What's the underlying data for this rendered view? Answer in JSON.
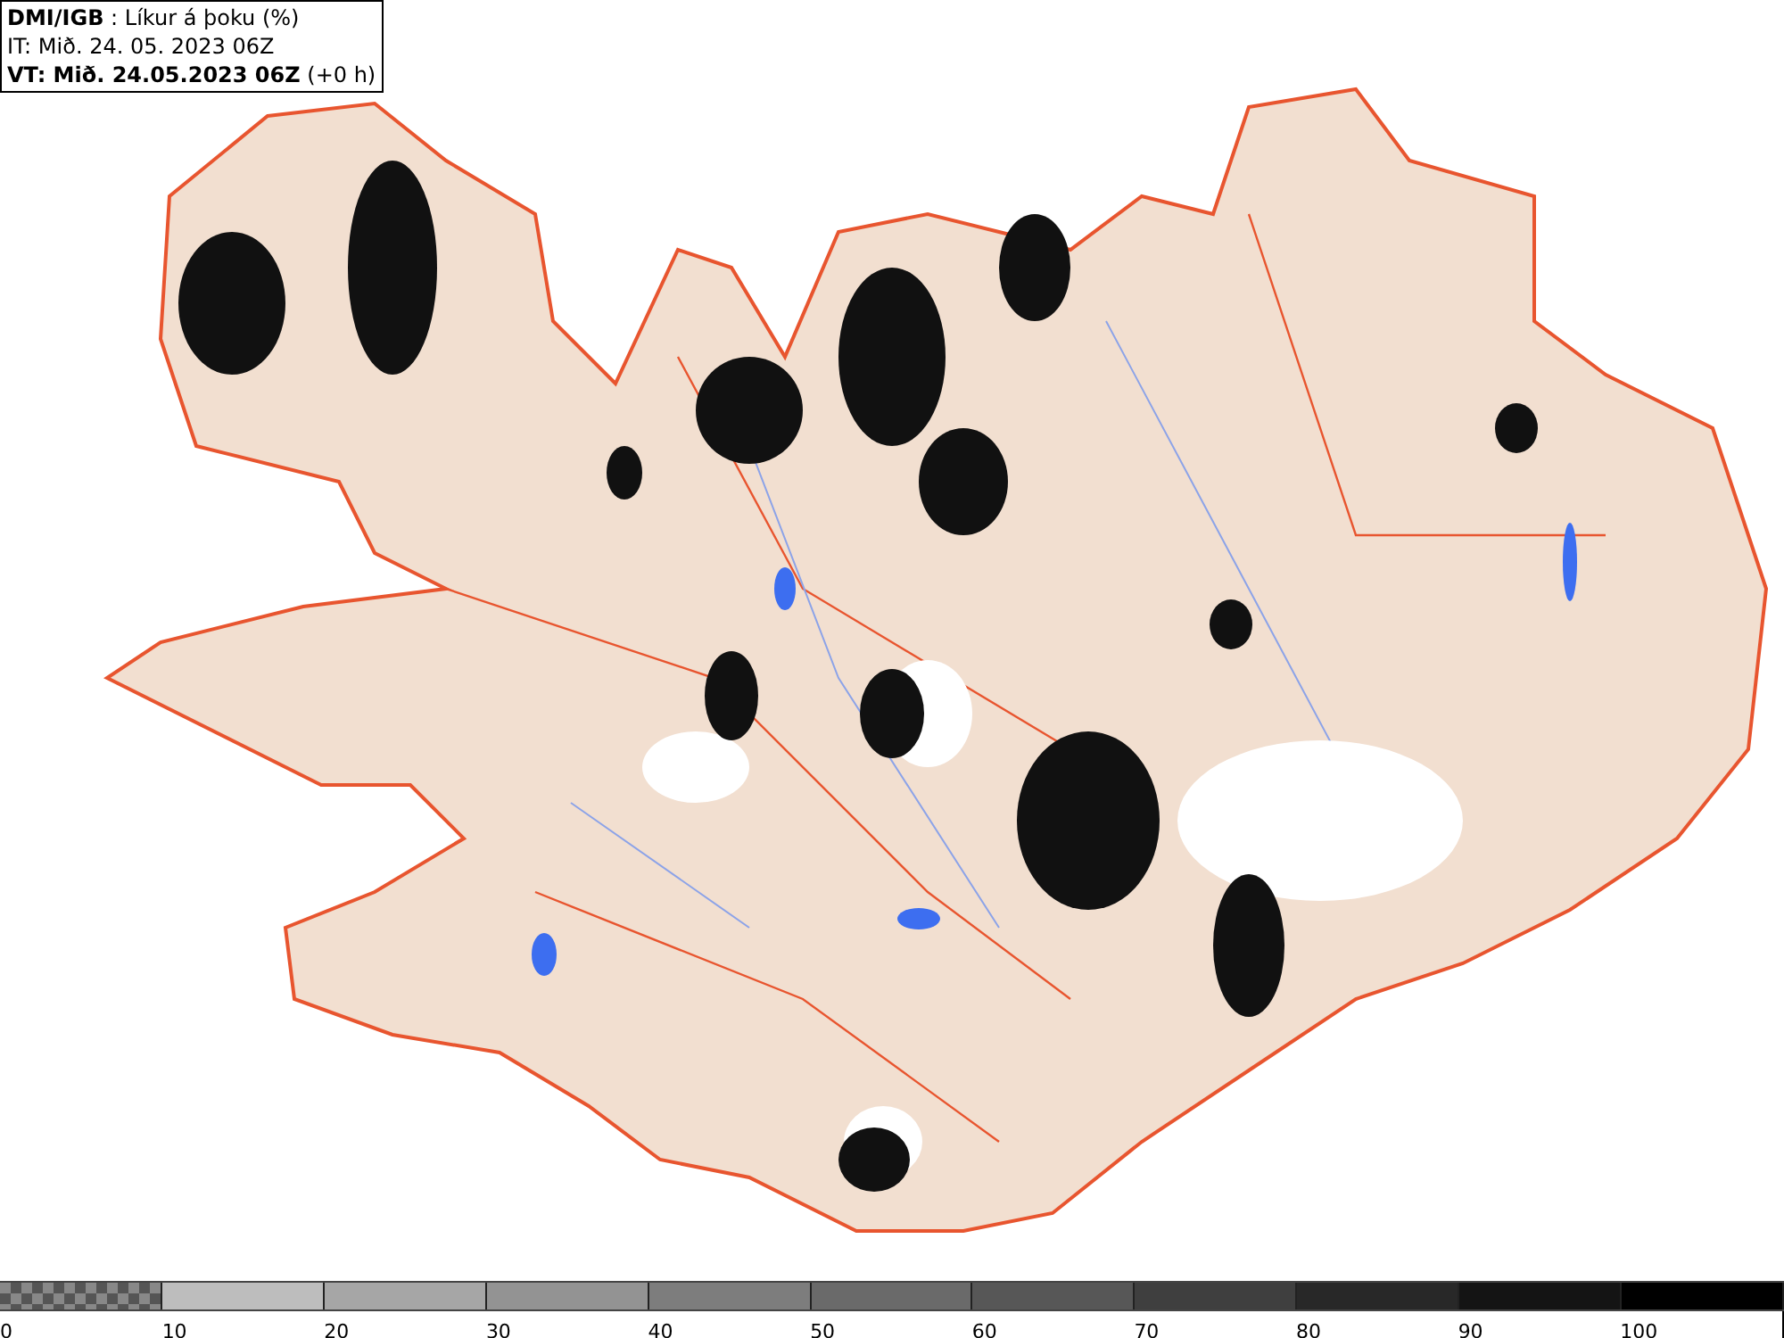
{
  "header": {
    "lines": [
      "**DMI/IGB** : Líkur á þoku (%)",
      "IT: Mið. 24. 05. 2023 06Z",
      "**VT: Mið. 24.05.2023 06Z** (+0 h)"
    ]
  },
  "colorbar": {
    "segments": [
      {
        "kind": "checker",
        "label": "0"
      },
      {
        "kind": "solid",
        "color": "#bdbdbd",
        "label": "10"
      },
      {
        "kind": "solid",
        "color": "#a6a6a6",
        "label": "20"
      },
      {
        "kind": "solid",
        "color": "#939393",
        "label": "30"
      },
      {
        "kind": "solid",
        "color": "#7d7d7d",
        "label": "40"
      },
      {
        "kind": "solid",
        "color": "#6a6a6a",
        "label": "50"
      },
      {
        "kind": "solid",
        "color": "#575757",
        "label": "60"
      },
      {
        "kind": "solid",
        "color": "#3f3f3f",
        "label": "70"
      },
      {
        "kind": "solid",
        "color": "#282828",
        "label": "80"
      },
      {
        "kind": "solid",
        "color": "#141414",
        "label": "90"
      },
      {
        "kind": "solid",
        "color": "#000000",
        "label": "100"
      }
    ]
  }
}
